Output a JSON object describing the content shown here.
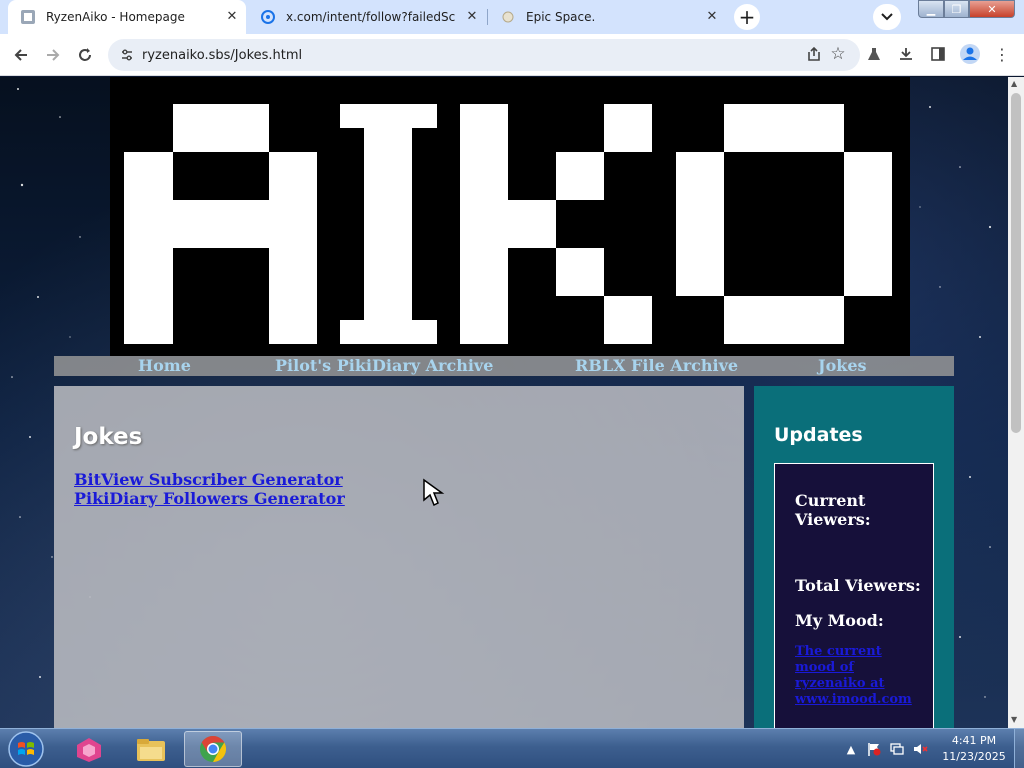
{
  "browser": {
    "tabs": [
      {
        "title": "RyzenAiko - Homepage",
        "icon": "page-icon"
      },
      {
        "title": "x.com/intent/follow?failedScript",
        "icon": "loading-icon"
      },
      {
        "title": "Epic Space.",
        "icon": "page-icon"
      }
    ],
    "url": "ryzenaiko.sbs/Jokes.html"
  },
  "site": {
    "logo_text": "AIKO",
    "nav": [
      "Home",
      "Pilot's PikiDiary Archive",
      "RBLX File Archive",
      "Jokes"
    ],
    "main": {
      "heading": "Jokes",
      "links": [
        "BitView Subscriber Generator",
        "PikiDiary Followers Generator"
      ]
    },
    "sidebar": {
      "heading": "Updates",
      "current_viewers": "Current Viewers:",
      "total_viewers": "Total Viewers:",
      "my_mood": "My Mood:",
      "mood_alt": "The current mood of ryzenaiko at www.imood.com"
    }
  },
  "taskbar": {
    "time": "4:41 PM",
    "date": "11/23/2025"
  },
  "colors": {
    "link": "#1a1ad8",
    "nav_link": "#a8d4ee",
    "sidebar_bg": "#0a6f7a",
    "sidebox_bg": "#16103a"
  }
}
